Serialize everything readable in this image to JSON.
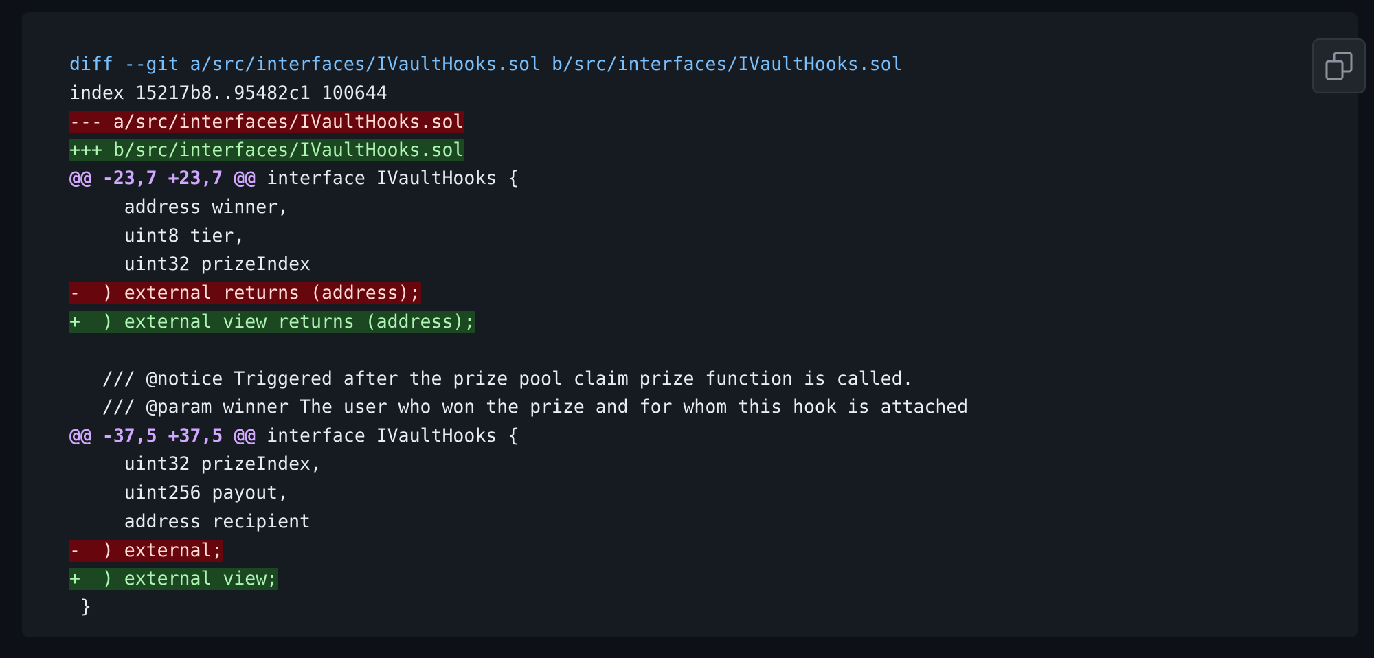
{
  "copy_button": {
    "icon": "copy-icon",
    "tooltip": ""
  },
  "colors": {
    "page_bg": "#0d1117",
    "card_bg": "#161b22",
    "deleted_bg": "#67060c",
    "added_bg": "#1b4721",
    "hunk_header": "#d2a8ff",
    "git_header": "#79c0ff"
  },
  "diff": {
    "header": {
      "git": "diff --git a/src/interfaces/IVaultHooks.sol b/src/interfaces/IVaultHooks.sol",
      "index": "index 15217b8..95482c1 100644",
      "old_file": "--- a/src/interfaces/IVaultHooks.sol",
      "new_file": "+++ b/src/interfaces/IVaultHooks.sol"
    },
    "hunks": [
      {
        "marker": "@@ -23,7 +23,7 @@",
        "context": " interface IVaultHooks {",
        "lines": [
          {
            "type": "context",
            "text": "     address winner,"
          },
          {
            "type": "context",
            "text": "     uint8 tier,"
          },
          {
            "type": "context",
            "text": "     uint32 prizeIndex"
          },
          {
            "type": "deleted",
            "text": "-  ) external returns (address);"
          },
          {
            "type": "added",
            "text": "+  ) external view returns (address);"
          },
          {
            "type": "context",
            "text": " "
          },
          {
            "type": "context",
            "text": "   /// @notice Triggered after the prize pool claim prize function is called."
          },
          {
            "type": "context",
            "text": "   /// @param winner The user who won the prize and for whom this hook is attached"
          }
        ]
      },
      {
        "marker": "@@ -37,5 +37,5 @@",
        "context": " interface IVaultHooks {",
        "lines": [
          {
            "type": "context",
            "text": "     uint32 prizeIndex,"
          },
          {
            "type": "context",
            "text": "     uint256 payout,"
          },
          {
            "type": "context",
            "text": "     address recipient"
          },
          {
            "type": "deleted",
            "text": "-  ) external;"
          },
          {
            "type": "added",
            "text": "+  ) external view;"
          },
          {
            "type": "context",
            "text": " }"
          }
        ]
      }
    ]
  }
}
